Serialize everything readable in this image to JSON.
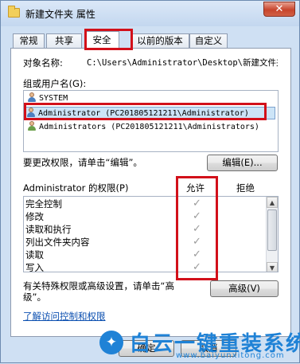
{
  "window": {
    "title": "新建文件夹 属性",
    "close_glyph": "✕"
  },
  "tabs": [
    {
      "label": "常规"
    },
    {
      "label": "共享"
    },
    {
      "label": "安全"
    },
    {
      "label": "以前的版本"
    },
    {
      "label": "自定义"
    }
  ],
  "object": {
    "label": "对象名称:",
    "value": "C:\\Users\\Administrator\\Desktop\\新建文件夹"
  },
  "groups": {
    "label": "组或用户名(G):",
    "items": [
      {
        "name": "SYSTEM",
        "icon": "user-icon"
      },
      {
        "name": "Administrator (PC201805121211\\Administrator)",
        "icon": "user-icon",
        "selected": true
      },
      {
        "name": "Administrators (PC201805121211\\Administrators)",
        "icon": "group-icon"
      }
    ]
  },
  "change_perms": {
    "text": "要更改权限，请单击“编辑”。",
    "edit_button": "编辑(E)..."
  },
  "permissions": {
    "header_label": "Administrator 的权限(P)",
    "allow_header": "允许",
    "deny_header": "拒绝",
    "check_glyph": "✓",
    "rows": [
      {
        "name": "完全控制",
        "allow": true
      },
      {
        "name": "修改",
        "allow": true
      },
      {
        "name": "读取和执行",
        "allow": true
      },
      {
        "name": "列出文件夹内容",
        "allow": true
      },
      {
        "name": "读取",
        "allow": true
      },
      {
        "name": "写入",
        "allow": true
      }
    ]
  },
  "advanced": {
    "text_line1": "有关特殊权限或高级设置，请单击“高",
    "text_line2": "级”。",
    "button": "高级(V)"
  },
  "link": "了解访问控制和权限",
  "bottom_buttons": {
    "ok_partial": "确定",
    "cancel_partial": "取消"
  },
  "watermark": {
    "title": "白云一键重装系统",
    "url": "www.baiyunxitong.com"
  },
  "colors": {
    "highlight_box": "#d2101a",
    "selection": "#cce4f7",
    "link": "#0b4fb0",
    "watermark": "#1f82d6"
  }
}
